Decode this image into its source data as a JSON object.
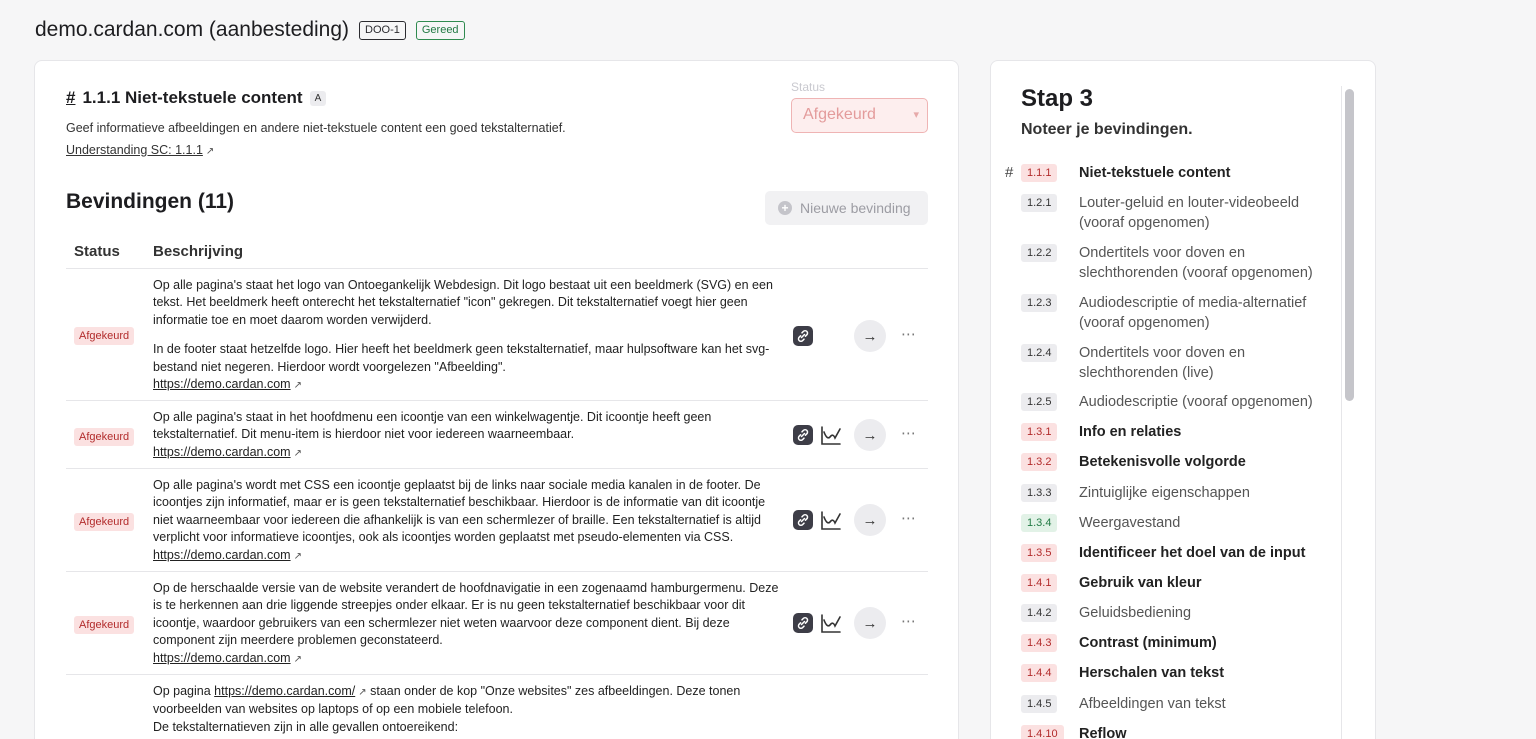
{
  "header": {
    "site_title": "demo.cardan.com (aanbesteding)",
    "tag_code": "DOO-1",
    "tag_status": "Gereed"
  },
  "criterion": {
    "hash": "#",
    "title": "1.1.1 Niet-tekstuele content",
    "level": "A",
    "description": "Geef informatieve afbeeldingen en andere niet-tekstuele content een goed tekstalternatief.",
    "understanding_link": "Understanding SC: 1.1.1",
    "status_label": "Status",
    "status_value": "Afgekeurd"
  },
  "findings": {
    "title": "Bevindingen (11)",
    "new_button": "Nieuwe bevinding",
    "col_status": "Status",
    "col_desc": "Beschrijving",
    "rows": [
      {
        "status": "Afgekeurd",
        "p1": "Op alle pagina's staat het logo van Ontoegankelijk Webdesign. Dit logo bestaat uit een beeldmerk (SVG) en een tekst. Het beeldmerk heeft onterecht het tekstalternatief \"icon\" gekregen. Dit tekstalternatief voegt hier geen informatie toe en moet daarom worden verwijderd.",
        "p2": "In de footer staat hetzelfde logo. Hier heeft het beeldmerk geen tekstalternatief, maar hulpsoftware kan het svg-bestand niet negeren. Hierdoor wordt voorgelezen \"Afbeelding\".",
        "url": "https://demo.cardan.com"
      },
      {
        "status": "Afgekeurd",
        "p1": "Op alle pagina's staat in het hoofdmenu een icoontje van een winkelwagentje. Dit icoontje heeft geen tekstalternatief. Dit menu-item is hierdoor niet voor iedereen waarneembaar.",
        "url": "https://demo.cardan.com"
      },
      {
        "status": "Afgekeurd",
        "p1": "Op alle pagina's wordt met CSS een icoontje geplaatst bij de links naar sociale media kanalen in de footer. De icoontjes zijn informatief, maar er is geen tekstalternatief beschikbaar. Hierdoor is de informatie van dit icoontje niet waarneembaar voor iedereen die afhankelijk is van een schermlezer of braille. Een tekstalternatief is altijd verplicht voor informatieve icoontjes, ook als icoontjes worden geplaatst met pseudo-elementen via CSS.",
        "url": "https://demo.cardan.com"
      },
      {
        "status": "Afgekeurd",
        "p1": "Op de herschaalde versie van de website verandert de hoofdnavigatie in een zogenaamd hamburgermenu. Deze is te herkennen aan drie liggende streepjes onder elkaar. Er is nu geen tekstalternatief beschikbaar voor dit icoontje, waardoor gebruikers van een schermlezer niet weten waarvoor deze component dient. Bij deze component zijn meerdere problemen geconstateerd.",
        "url": "https://demo.cardan.com"
      },
      {
        "p_prefix": "Op pagina",
        "url": "https://demo.cardan.com/",
        "p_suffix": "staan onder de kop \"Onze websites\" zes afbeeldingen. Deze tonen voorbeelden van websites op laptops of op een mobiele telefoon.",
        "p_line3": "De tekstalternatieven zijn in alle gevallen ontoereikend:"
      }
    ]
  },
  "sidebar": {
    "step_title": "Stap 3",
    "step_sub": "Noteer je bevindingen.",
    "current_hash": "#",
    "items": [
      {
        "code": "1.1.1",
        "label": "Niet-tekstuele content",
        "state": "red",
        "bold": true
      },
      {
        "code": "1.2.1",
        "label": "Louter-geluid en louter-videobeeld (vooraf opgenomen)",
        "state": "grey",
        "bold": false
      },
      {
        "code": "1.2.2",
        "label": "Ondertitels voor doven en slechthorenden (vooraf opgenomen)",
        "state": "grey",
        "bold": false
      },
      {
        "code": "1.2.3",
        "label": "Audiodescriptie of media-alternatief (vooraf opgenomen)",
        "state": "grey",
        "bold": false
      },
      {
        "code": "1.2.4",
        "label": "Ondertitels voor doven en slechthorenden (live)",
        "state": "grey",
        "bold": false
      },
      {
        "code": "1.2.5",
        "label": "Audiodescriptie (vooraf opgenomen)",
        "state": "grey",
        "bold": false
      },
      {
        "code": "1.3.1",
        "label": "Info en relaties",
        "state": "red",
        "bold": true
      },
      {
        "code": "1.3.2",
        "label": "Betekenisvolle volgorde",
        "state": "red",
        "bold": true
      },
      {
        "code": "1.3.3",
        "label": "Zintuiglijke eigenschappen",
        "state": "grey",
        "bold": false
      },
      {
        "code": "1.3.4",
        "label": "Weergavestand",
        "state": "green",
        "bold": false
      },
      {
        "code": "1.3.5",
        "label": "Identificeer het doel van de input",
        "state": "red",
        "bold": true
      },
      {
        "code": "1.4.1",
        "label": "Gebruik van kleur",
        "state": "red",
        "bold": true
      },
      {
        "code": "1.4.2",
        "label": "Geluidsbediening",
        "state": "grey",
        "bold": false
      },
      {
        "code": "1.4.3",
        "label": "Contrast (minimum)",
        "state": "red",
        "bold": true
      },
      {
        "code": "1.4.4",
        "label": "Herschalen van tekst",
        "state": "red",
        "bold": true
      },
      {
        "code": "1.4.5",
        "label": "Afbeeldingen van tekst",
        "state": "grey",
        "bold": false
      },
      {
        "code": "1.4.10",
        "label": "Reflow",
        "state": "red",
        "bold": true
      }
    ]
  },
  "icons": {
    "external": "external-link-icon",
    "link": "link-icon",
    "chart": "chart-icon",
    "arrow": "arrow-right-icon",
    "more": "more-icon",
    "plus": "plus-circle-icon"
  }
}
